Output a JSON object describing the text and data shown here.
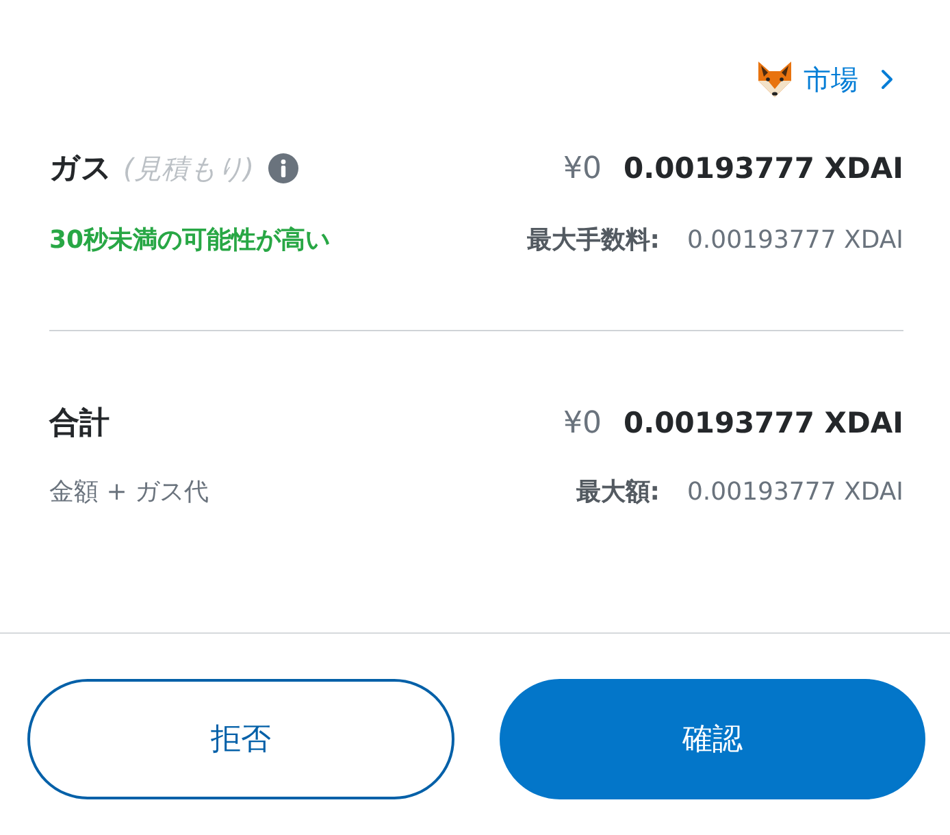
{
  "market_link": {
    "label": "市場"
  },
  "gas": {
    "title": "ガス",
    "subtitle": "(見積もり)",
    "fiat": "¥0",
    "amount": "0.00193777 XDAI",
    "speed": "30秒未満の可能性が高い",
    "max_label": "最大手数料:",
    "max_value": "0.00193777 XDAI"
  },
  "total": {
    "title": "合計",
    "fiat": "¥0",
    "amount": "0.00193777 XDAI",
    "note": "金額 + ガス代",
    "max_label": "最大額:",
    "max_value": "0.00193777 XDAI"
  },
  "buttons": [
    {
      "label": "拒否",
      "kind": "secondary"
    },
    {
      "label": "確認",
      "kind": "primary"
    }
  ]
}
